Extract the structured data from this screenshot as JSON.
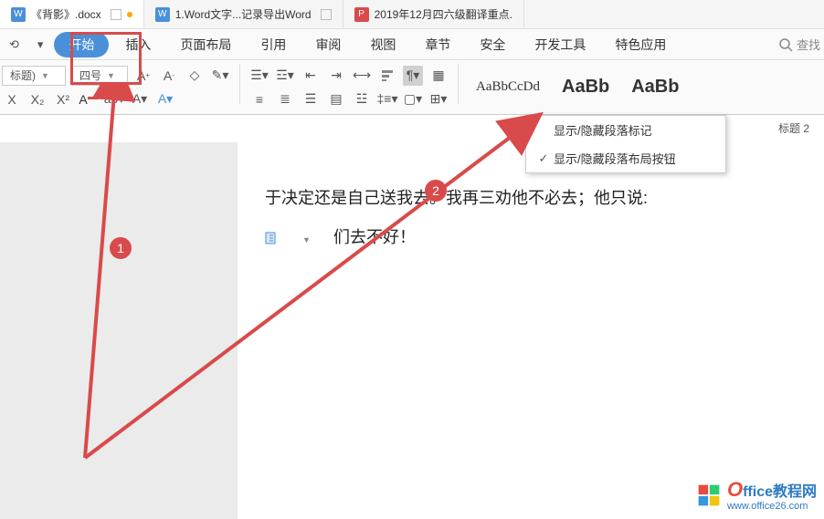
{
  "tabs": [
    {
      "icon": "W",
      "label": "《背影》.docx",
      "iconClass": "blue"
    },
    {
      "icon": "W",
      "label": "1.Word文字...记录导出Word",
      "iconClass": "blue"
    },
    {
      "icon": "P",
      "label": "2019年12月四六级翻译重点.",
      "iconClass": "red"
    }
  ],
  "ribbon": {
    "tabs": [
      "开始",
      "插入",
      "页面布局",
      "引用",
      "审阅",
      "视图",
      "章节",
      "安全",
      "开发工具",
      "特色应用"
    ],
    "active": "开始",
    "search": "查找"
  },
  "toolbar": {
    "fontName": "标题)",
    "fontSize": "四号",
    "style1": "AaBbCcDd",
    "style2": "AaBb",
    "style3": "AaBb",
    "styleCaption": "标题 2"
  },
  "menu": {
    "item1": "显示/隐藏段落标记",
    "item2": "显示/隐藏段落布局按钮"
  },
  "document": {
    "line1": "于决定还是自己送我去。我再三劝他不必去；他只说:",
    "line2": "们去不好！"
  },
  "badges": {
    "b1": "1",
    "b2": "2"
  },
  "watermark": {
    "title_o": "O",
    "title_rest": "ffice教程网",
    "url": "www.office26.com"
  }
}
